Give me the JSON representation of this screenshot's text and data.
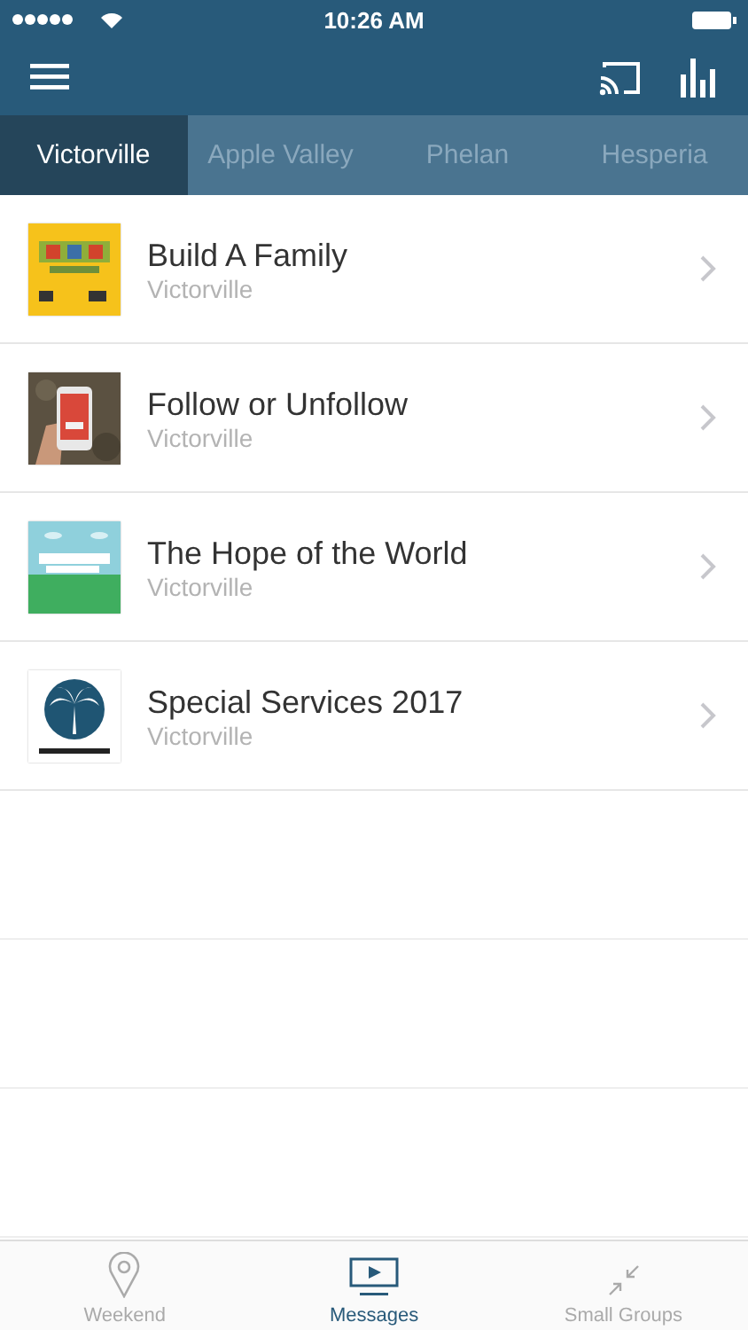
{
  "status_bar": {
    "time": "10:26 AM"
  },
  "tabs": [
    {
      "label": "Victorville",
      "selected": true
    },
    {
      "label": "Apple Valley",
      "selected": false
    },
    {
      "label": "Phelan",
      "selected": false
    },
    {
      "label": "Hesperia",
      "selected": false
    }
  ],
  "messages": [
    {
      "title": "Build A Family",
      "subtitle": "Victorville"
    },
    {
      "title": "Follow or Unfollow",
      "subtitle": "Victorville"
    },
    {
      "title": "The Hope of the World",
      "subtitle": "Victorville"
    },
    {
      "title": "Special Services 2017",
      "subtitle": "Victorville"
    }
  ],
  "bottom_tabs": [
    {
      "label": "Weekend",
      "selected": false
    },
    {
      "label": "Messages",
      "selected": true
    },
    {
      "label": "Small Groups",
      "selected": false
    }
  ]
}
